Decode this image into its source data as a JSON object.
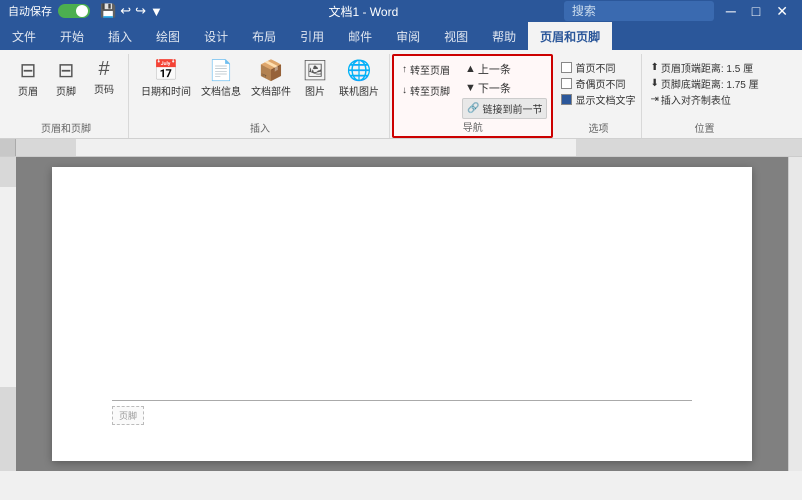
{
  "titlebar": {
    "autosave": "自动保存",
    "toggle_state": "on",
    "doc_title": "文档1 - Word",
    "search_placeholder": "搜索",
    "undo": "↩",
    "redo": "↪",
    "customize": "▼"
  },
  "ribbon": {
    "tabs": [
      {
        "id": "file",
        "label": "文件"
      },
      {
        "id": "home",
        "label": "开始"
      },
      {
        "id": "insert",
        "label": "插入"
      },
      {
        "id": "draw",
        "label": "绘图"
      },
      {
        "id": "design",
        "label": "设计"
      },
      {
        "id": "layout",
        "label": "布局"
      },
      {
        "id": "refs",
        "label": "引用"
      },
      {
        "id": "mail",
        "label": "邮件"
      },
      {
        "id": "review",
        "label": "审阅"
      },
      {
        "id": "view",
        "label": "视图"
      },
      {
        "id": "help",
        "label": "帮助"
      },
      {
        "id": "header-footer",
        "label": "页眉和页脚",
        "active": true
      }
    ],
    "groups": {
      "insert": {
        "label": "页眉和页脚",
        "buttons": [
          {
            "id": "header",
            "label": "页眉",
            "icon": "⊟"
          },
          {
            "id": "footer",
            "label": "页脚",
            "icon": "⊟"
          },
          {
            "id": "page-num",
            "label": "页码",
            "icon": "#"
          }
        ]
      },
      "insert2": {
        "label": "插入",
        "buttons": [
          {
            "id": "datetime",
            "label": "日期和时间",
            "icon": "📅"
          },
          {
            "id": "docinfo",
            "label": "文档信息",
            "icon": "📄"
          },
          {
            "id": "docparts",
            "label": "文档部件",
            "icon": "📦"
          },
          {
            "id": "pic",
            "label": "图片",
            "icon": "🖼"
          },
          {
            "id": "online-pic",
            "label": "联机图片",
            "icon": "🌐"
          },
          {
            "id": "goto-header",
            "label": "转至页眉",
            "icon": "↑"
          },
          {
            "id": "goto-footer",
            "label": "转至页脚",
            "icon": "↓"
          }
        ]
      },
      "navigation": {
        "label": "导航",
        "highlighted": true,
        "items": [
          {
            "id": "prev",
            "label": "上一条",
            "icon": "▲"
          },
          {
            "id": "next",
            "label": "下一条",
            "icon": "▼"
          },
          {
            "id": "link",
            "label": "链接到前一节",
            "icon": "🔗",
            "is_button": true
          }
        ]
      },
      "options": {
        "label": "选项",
        "items": [
          {
            "id": "first-page",
            "label": "首页不同",
            "checked": false
          },
          {
            "id": "odd-even",
            "label": "奇偶页不同",
            "checked": false
          },
          {
            "id": "show-doc-text",
            "label": "显示文档文字",
            "checked": true
          }
        ]
      },
      "position": {
        "label": "位置",
        "items": [
          {
            "id": "header-top",
            "label": "页眉顶端距离",
            "value": "1.5 厘"
          },
          {
            "id": "footer-bottom",
            "label": "页脚底端距离",
            "value": "1.75 厘"
          },
          {
            "id": "insert-align",
            "label": "插入对齐制表位"
          }
        ]
      }
    }
  },
  "document": {
    "footer_label": "页脚"
  }
}
